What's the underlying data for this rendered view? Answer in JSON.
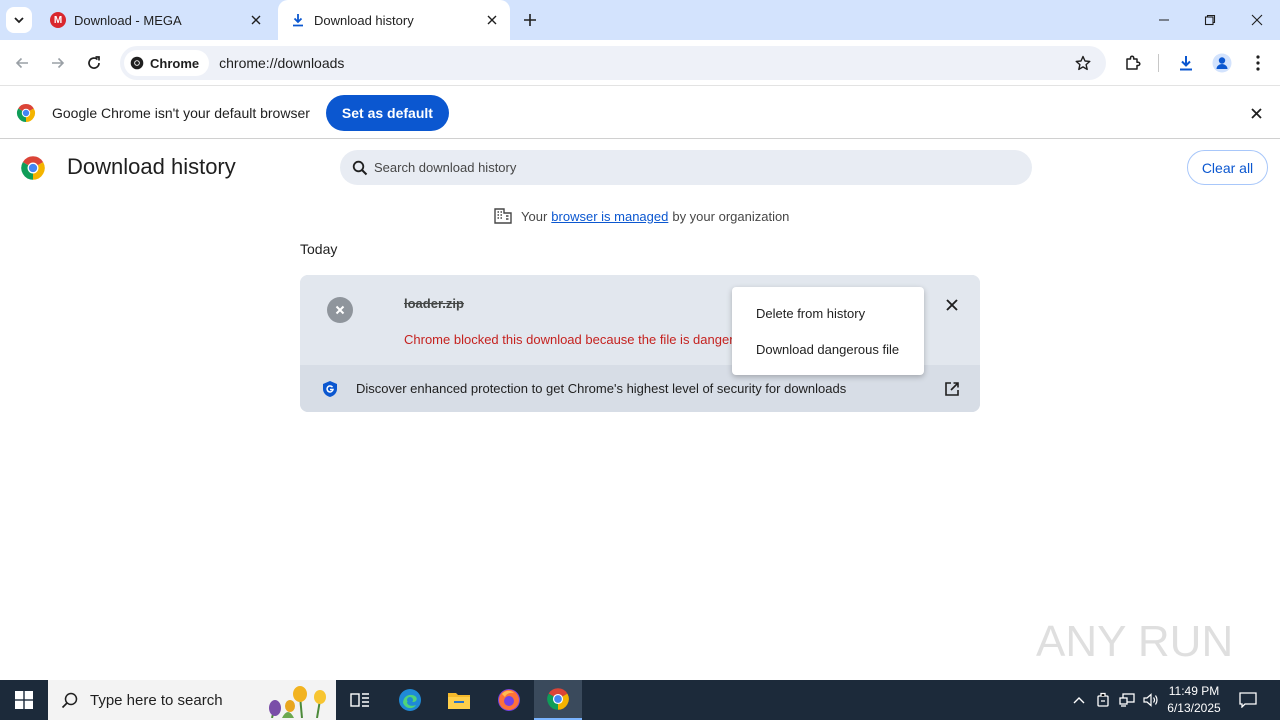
{
  "tabs": [
    {
      "title": "Download - MEGA",
      "favicon": "M"
    },
    {
      "title": "Download history"
    }
  ],
  "toolbar": {
    "chip_label": "Chrome",
    "url": "chrome://downloads"
  },
  "infobar": {
    "message": "Google Chrome isn't your default browser",
    "button": "Set as default"
  },
  "page": {
    "title": "Download history",
    "search_placeholder": "Search download history",
    "clear_all": "Clear all",
    "managed_prefix": "Your",
    "managed_link": "browser is managed",
    "managed_suffix": "by your organization",
    "section": "Today"
  },
  "download": {
    "filename": "loader.zip",
    "status": "Chrome blocked this download because the file is dangerous",
    "footer": "Discover enhanced protection to get Chrome's highest level of security for downloads"
  },
  "context_menu": {
    "items": [
      "Delete from history",
      "Download dangerous file"
    ]
  },
  "taskbar": {
    "search_placeholder": "Type here to search",
    "time": "11:49 PM",
    "date": "6/13/2025"
  },
  "watermark": "ANY RUN",
  "colors": {
    "accent": "#0b57d0",
    "danger": "#c5221f",
    "tabstrip": "#d3e3fd"
  }
}
